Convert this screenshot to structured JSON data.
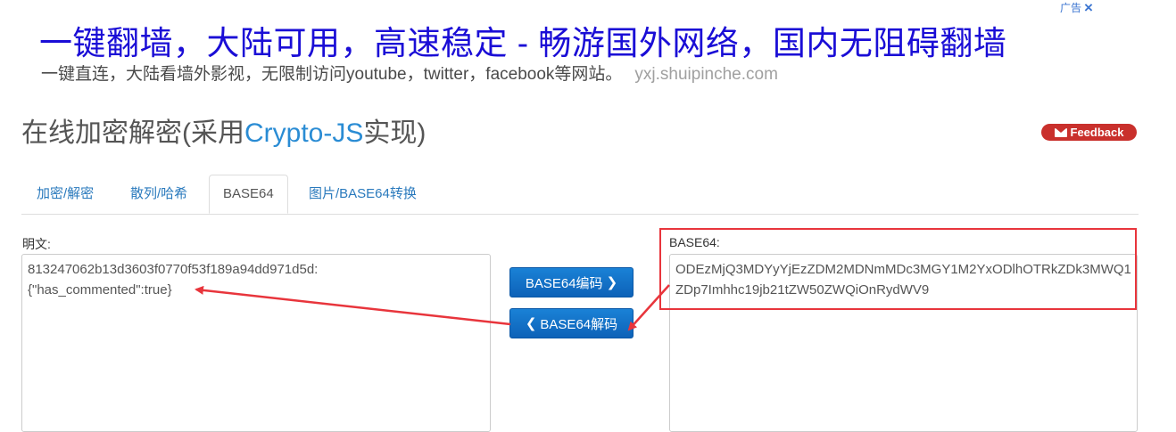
{
  "ad": {
    "badge": "广告",
    "close_icon": "×",
    "title": "一键翻墙，大陆可用，高速稳定 - 畅游国外网络，国内无阻碍翻墙",
    "description": "一键直连，大陆看墙外影视，无限制访问youtube，twitter，facebook等网站。",
    "url": "yxj.shuipinche.com"
  },
  "page": {
    "title_prefix": "在线加密解密(采用",
    "title_highlight": "Crypto-JS",
    "title_suffix": "实现)"
  },
  "feedback_label": "Feedback",
  "tabs": [
    {
      "label": "加密/解密"
    },
    {
      "label": "散列/哈希"
    },
    {
      "label": "BASE64"
    },
    {
      "label": "图片/BASE64转换"
    }
  ],
  "plain": {
    "label": "明文:",
    "value": "813247062b13d3603f0770f53f189a94dd971d5d:\n{\"has_commented\":true}"
  },
  "base64": {
    "label": "BASE64:",
    "value": "ODEzMjQ3MDYyYjEzZDM2MDNmMDc3MGY1M2YxODlhOTRkZDk3MWQ1ZDp7Imhhc19jb21tZW50ZWQiOnRydWV9"
  },
  "buttons": {
    "encode": "BASE64编码",
    "decode": "BASE64解码"
  },
  "colors": {
    "annotation": "#e8353c",
    "button": "#1a82d6",
    "feedback": "#c9302c"
  }
}
